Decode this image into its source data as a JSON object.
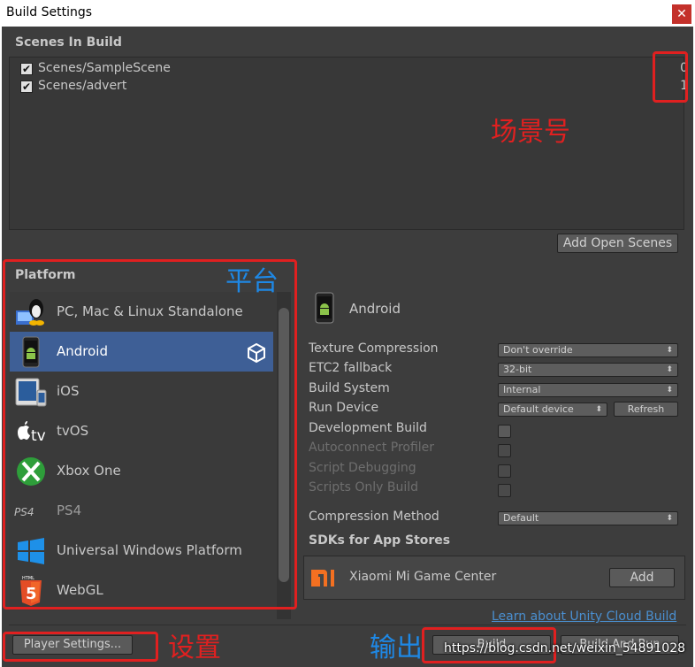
{
  "window": {
    "title": "Build Settings",
    "close_glyph": "✕"
  },
  "scenes": {
    "header": "Scenes In Build",
    "items": [
      {
        "name": "Scenes/SampleScene",
        "index": "0",
        "checked": true
      },
      {
        "name": "Scenes/advert",
        "index": "1",
        "checked": true
      }
    ],
    "add_open_label": "Add Open Scenes"
  },
  "platform": {
    "header": "Platform",
    "items": [
      {
        "name": "PC, Mac & Linux Standalone",
        "icon": "pc-mac-linux-icon"
      },
      {
        "name": "Android",
        "icon": "android-icon",
        "selected": true
      },
      {
        "name": "iOS",
        "icon": "ios-device-icon"
      },
      {
        "name": "tvOS",
        "icon": "apple-tv-icon",
        "prefix": "tv"
      },
      {
        "name": "Xbox One",
        "icon": "xbox-icon"
      },
      {
        "name": "PS4",
        "icon": "ps4-icon",
        "prefix": "PS4"
      },
      {
        "name": "Universal Windows Platform",
        "icon": "windows-icon"
      },
      {
        "name": "WebGL",
        "icon": "html5-icon",
        "prefix": "HTML"
      }
    ]
  },
  "settings": {
    "header": "Android",
    "texture_compression": {
      "label": "Texture Compression",
      "value": "Don't override"
    },
    "etc2_fallback": {
      "label": "ETC2 fallback",
      "value": "32-bit"
    },
    "build_system": {
      "label": "Build System",
      "value": "Internal"
    },
    "run_device": {
      "label": "Run Device",
      "value": "Default device",
      "refresh": "Refresh"
    },
    "development_build": {
      "label": "Development Build"
    },
    "autoconnect_profiler": {
      "label": "Autoconnect Profiler"
    },
    "script_debugging": {
      "label": "Script Debugging"
    },
    "scripts_only_build": {
      "label": "Scripts Only Build"
    },
    "compression_method": {
      "label": "Compression Method",
      "value": "Default"
    },
    "sdks_header": "SDKs for App Stores",
    "sdk": {
      "name": "Xiaomi Mi Game Center",
      "add_label": "Add",
      "logo_text": "mi"
    }
  },
  "footer": {
    "learn_link": "Learn about Unity Cloud Build",
    "player_settings": "Player Settings...",
    "build": "Build",
    "build_and_run": "Build And Run"
  },
  "annotations": {
    "scene_number": "场景号",
    "platform": "平台",
    "settings": "设置",
    "output": "输出"
  },
  "watermark": "https://blog.csdn.net/weixin_54891028",
  "colors": {
    "panel_bg": "#3d3d3d",
    "selection": "#3e5f96",
    "annotation_red": "#e02020",
    "annotation_blue": "#1e88e5",
    "link": "#4a8fd0"
  }
}
